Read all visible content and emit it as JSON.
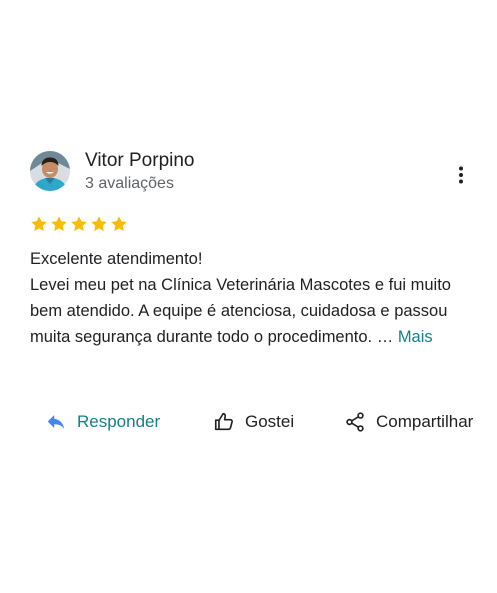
{
  "review": {
    "reviewer_name": "Vitor Porpino",
    "review_count": "3 avaliações",
    "rating": 5,
    "rating_max": 5,
    "text_line1": "Excelente atendimento!",
    "text_body": "Levei meu pet na Clínica Veterinária Mascotes e fui muito bem atendido. A equipe é atenciosa, cuidadosa e passou muita segurança durante todo o procedimento. …",
    "more_label": "Mais"
  },
  "actions": {
    "reply_label": "Responder",
    "like_label": "Gostei",
    "share_label": "Compartilhar"
  },
  "icons": {
    "more": "more-vertical-icon",
    "star": "star-icon",
    "reply": "reply-icon",
    "like": "thumbs-up-icon",
    "share": "share-icon"
  },
  "colors": {
    "star": "#fbbc04",
    "accent": "#137f8a",
    "reply_icon": "#4285f4",
    "secondary_text": "#5f6368",
    "primary_text": "#202124"
  }
}
